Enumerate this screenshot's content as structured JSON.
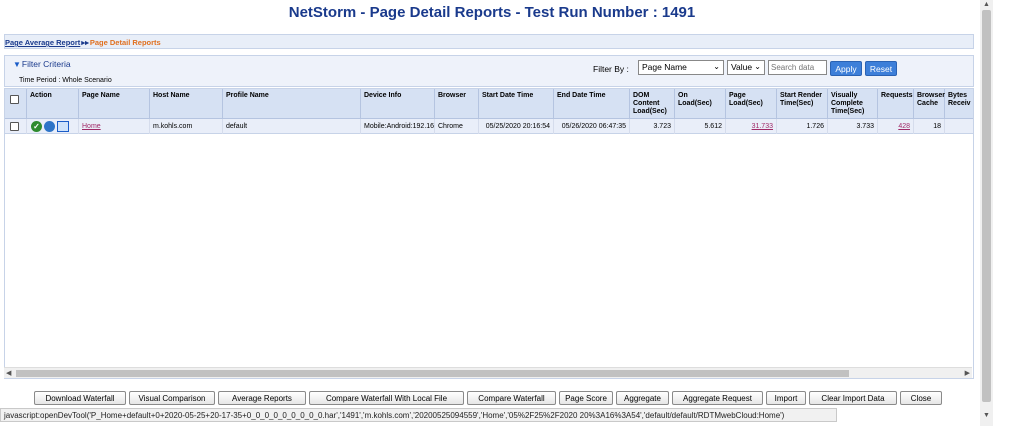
{
  "title": "NetStorm - Page Detail Reports - Test Run Number : 1491",
  "breadcrumb": {
    "parent": "Page Average Report",
    "separator": "▸▸",
    "current": "Page Detail Reports"
  },
  "filter": {
    "title": "Filter Criteria",
    "time_period": "Time Period : Whole Scenario",
    "filter_by_label": "Filter By :",
    "field_select": "Page Name",
    "op_select": "Value",
    "search_placeholder": "Search data",
    "apply_label": "Apply",
    "reset_label": "Reset"
  },
  "table": {
    "headers": {
      "action": "Action",
      "page_name": "Page Name",
      "host_name": "Host Name",
      "profile_name": "Profile Name",
      "device_info": "Device Info",
      "browser": "Browser",
      "start_date_time": "Start Date Time",
      "end_date_time": "End Date Time",
      "dom_content_load": "DOM Content Load(Sec)",
      "on_load": "On Load(Sec)",
      "page_load": "Page Load(Sec)",
      "start_render": "Start Render Time(Sec)",
      "visually_complete": "Visually Complete Time(Sec)",
      "requests": "Requests",
      "browser_cache": "Browser Cache",
      "bytes_received": "Bytes Receiv"
    },
    "rows": [
      {
        "page_name": "Home",
        "host_name": "m.kohls.com",
        "profile_name": "default",
        "device_info": "Mobile:Android:192.16",
        "browser": "Chrome",
        "start_date_time": "05/25/2020 20:16:54",
        "end_date_time": "05/26/2020 06:47:35",
        "dom_content_load": "3.723",
        "on_load": "5.612",
        "page_load": "31.733",
        "start_render": "1.726",
        "visually_complete": "3.733",
        "requests": "428",
        "browser_cache": "18"
      }
    ]
  },
  "buttons": {
    "download_waterfall": "Download Waterfall",
    "visual_comparison": "Visual Comparison",
    "average_reports": "Average Reports",
    "compare_local": "Compare Waterfall With Local File",
    "compare_waterfall": "Compare Waterfall",
    "page_score": "Page Score",
    "aggregate": "Aggregate",
    "aggregate_request": "Aggregate Request",
    "import": "Import",
    "clear_import": "Clear Import Data",
    "close": "Close"
  },
  "status_bar": "javascript:openDevTool('P_Home+default+0+2020-05-25+20-17-35+0_0_0_0_0_0_0_0_0.har','1491','m.kohls.com','20200525094559','Home','05%2F25%2F2020 20%3A16%3A54','default/default/RDTMwebCloud:Home')",
  "icons": {
    "check": "check-circle-icon",
    "gauge": "gauge-icon",
    "screen": "screen-icon"
  },
  "colors": {
    "title": "#1a3a8c",
    "header_bg": "#d6e1f3",
    "row_bg": "#e9eef9",
    "link": "#a02a68",
    "accent_button": "#3d7fd9"
  }
}
